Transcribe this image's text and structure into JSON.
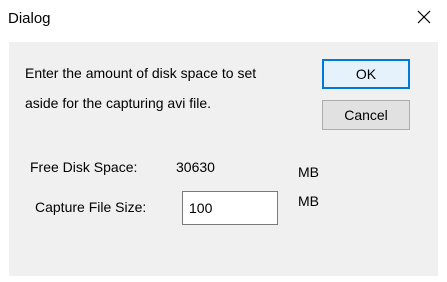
{
  "window": {
    "title": "Dialog",
    "close_glyph": "close-icon"
  },
  "message": {
    "line1": "Enter the amount of disk space to set",
    "line2": "aside for the capturing avi file."
  },
  "buttons": {
    "ok_label": "OK",
    "cancel_label": "Cancel"
  },
  "free_disk": {
    "label": "Free Disk Space:",
    "value": "30630",
    "unit": "MB"
  },
  "capture_size": {
    "label": "Capture File Size:",
    "value": "100",
    "unit": "MB"
  },
  "colors": {
    "client_background": "#f0f0f0",
    "default_button_border": "#0078d7"
  }
}
